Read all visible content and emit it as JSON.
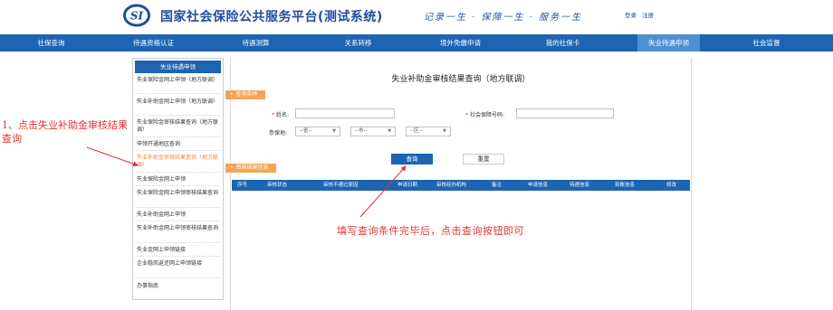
{
  "header": {
    "site_title": "国家社会保险公共服务平台(测试系统)",
    "slogan": "记录一生 · 保障一生 · 服务一生",
    "login": "登录",
    "register": "注册",
    "brand_color": "#1f4e9e"
  },
  "nav": {
    "items": [
      "社保查询",
      "待遇资格认证",
      "待遇测算",
      "关系转移",
      "境外免缴申请",
      "我的社保卡",
      "失业待遇申领",
      "社会监督"
    ],
    "active_index": 6,
    "bg_color": "#1d64b3"
  },
  "sidebar": {
    "header": "失业待遇申领",
    "items": [
      "失业保险金网上申领（地方联调）",
      "失业补助金网上申领（地方联调）",
      "失业保险金审核结果查询（地方联调）",
      "申领开通地区查询",
      "失业补助金审核结果查询（地方联调）",
      "失业保险金网上申领",
      "失业保险金网上申领审核结果查询",
      "失业补助金网上申领",
      "失业补助金网上申领审核结果查询",
      "失业金网上申领链接",
      "企业稳岗返还网上申领链接",
      "办事指南"
    ],
    "active_index": 4
  },
  "main": {
    "title": "失业补助金审核结果查询（地方联调）",
    "query_section": "查询条件",
    "result_section": "审核结果信息",
    "name_label": "姓名:",
    "ssn_label": "社会保障号码:",
    "insured_place_label": "参保地:",
    "selects": [
      "--省--",
      "--市--",
      "--区--"
    ],
    "query_button": "查询",
    "reset_button": "重置",
    "table_headers": [
      "序号",
      "审核状态",
      "审核不通过原因",
      "申请日期",
      "审核经办机构",
      "备注",
      "申请信息",
      "待遇信息",
      "到账信息",
      "修改"
    ],
    "accent_color": "#f3a45a"
  },
  "annotations": {
    "left_note": "1、点击失业补助金审核结果查询",
    "bottom_note": "填写查询条件完毕后，点击查询按钮即可",
    "color": "#e3342f"
  }
}
